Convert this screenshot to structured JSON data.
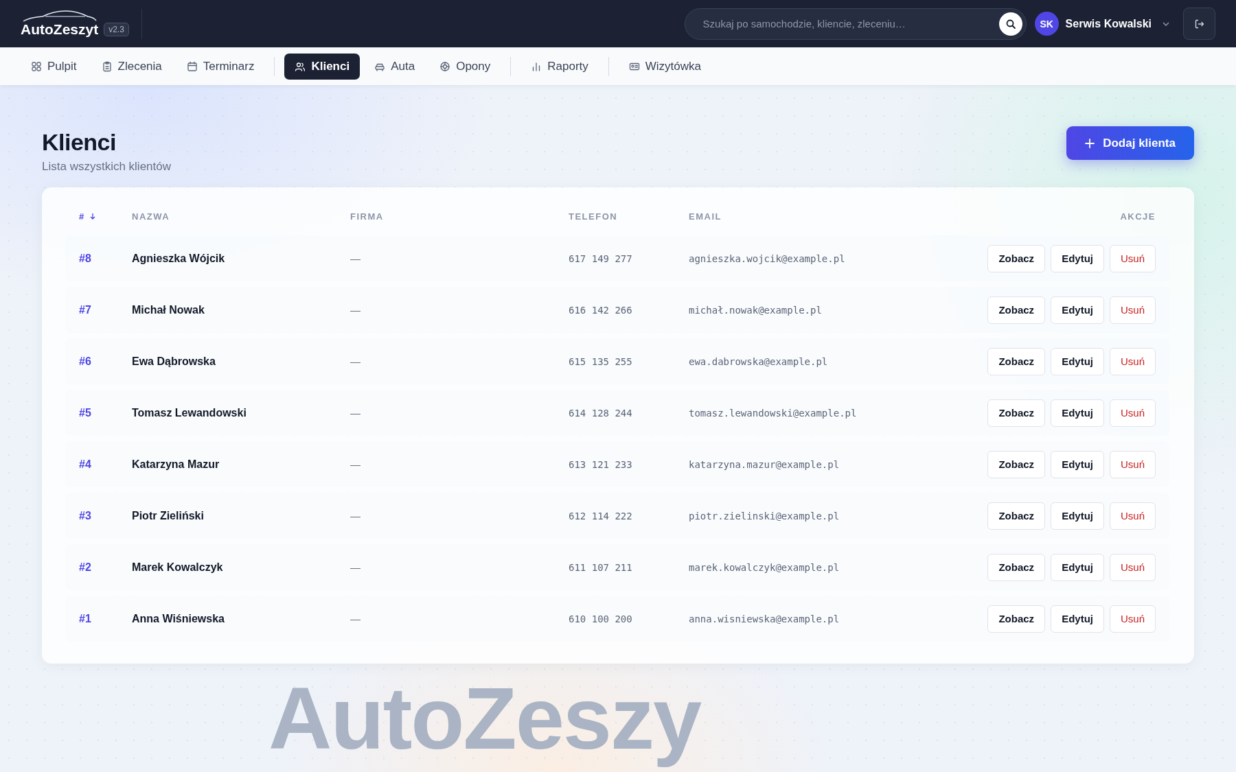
{
  "app": {
    "logo": "AutoZeszyt",
    "version": "v2.3"
  },
  "search": {
    "placeholder": "Szukaj po samochodzie, kliencie, zleceniu…"
  },
  "user": {
    "initials": "SK",
    "name": "Serwis Kowalski"
  },
  "nav": [
    [
      {
        "label": "Pulpit",
        "selected": false
      },
      {
        "label": "Zlecenia",
        "selected": false
      },
      {
        "label": "Terminarz",
        "selected": false
      }
    ],
    [
      {
        "label": "Klienci",
        "selected": true
      },
      {
        "label": "Auta",
        "selected": false
      },
      {
        "label": "Opony",
        "selected": false
      }
    ],
    [
      {
        "label": "Raporty",
        "selected": false
      }
    ],
    [
      {
        "label": "Wizytówka",
        "selected": false
      }
    ]
  ],
  "page": {
    "title": "Klienci",
    "subtitle": "Lista wszystkich klientów",
    "add_button": "Dodaj klienta"
  },
  "table": {
    "columns": [
      {
        "label": "#",
        "sorted": true
      },
      {
        "label": "NAZWA"
      },
      {
        "label": "FIRMA"
      },
      {
        "label": "TELEFON"
      },
      {
        "label": "EMAIL"
      },
      {
        "label": "AKCJE"
      }
    ],
    "rows": [
      {
        "id": "#8",
        "name": "Agnieszka Wójcik",
        "company": "—",
        "phone": "617 149 277",
        "email": "agnieszka.wojcik@example.pl",
        "actions": [
          {
            "label": "Zobacz",
            "kind": "normal"
          },
          {
            "label": "Edytuj",
            "kind": "normal"
          },
          {
            "label": "Usuń",
            "kind": "danger"
          }
        ]
      },
      {
        "id": "#7",
        "name": "Michał Nowak",
        "company": "—",
        "phone": "616 142 266",
        "email": "michał.nowak@example.pl",
        "actions": [
          {
            "label": "Zobacz",
            "kind": "normal"
          },
          {
            "label": "Edytuj",
            "kind": "normal"
          },
          {
            "label": "Usuń",
            "kind": "danger"
          }
        ]
      },
      {
        "id": "#6",
        "name": "Ewa Dąbrowska",
        "company": "—",
        "phone": "615 135 255",
        "email": "ewa.dabrowska@example.pl",
        "actions": [
          {
            "label": "Zobacz",
            "kind": "normal"
          },
          {
            "label": "Edytuj",
            "kind": "normal"
          },
          {
            "label": "Usuń",
            "kind": "danger"
          }
        ]
      },
      {
        "id": "#5",
        "name": "Tomasz Lewandowski",
        "company": "—",
        "phone": "614 128 244",
        "email": "tomasz.lewandowski@example.pl",
        "actions": [
          {
            "label": "Zobacz",
            "kind": "normal"
          },
          {
            "label": "Edytuj",
            "kind": "normal"
          },
          {
            "label": "Usuń",
            "kind": "danger"
          }
        ]
      },
      {
        "id": "#4",
        "name": "Katarzyna Mazur",
        "company": "—",
        "phone": "613 121 233",
        "email": "katarzyna.mazur@example.pl",
        "actions": [
          {
            "label": "Zobacz",
            "kind": "normal"
          },
          {
            "label": "Edytuj",
            "kind": "normal"
          },
          {
            "label": "Usuń",
            "kind": "danger"
          }
        ]
      },
      {
        "id": "#3",
        "name": "Piotr Zieliński",
        "company": "—",
        "phone": "612 114 222",
        "email": "piotr.zielinski@example.pl",
        "actions": [
          {
            "label": "Zobacz",
            "kind": "normal"
          },
          {
            "label": "Edytuj",
            "kind": "normal"
          },
          {
            "label": "Usuń",
            "kind": "danger"
          }
        ]
      },
      {
        "id": "#2",
        "name": "Marek Kowalczyk",
        "company": "—",
        "phone": "611 107 211",
        "email": "marek.kowalczyk@example.pl",
        "actions": [
          {
            "label": "Zobacz",
            "kind": "normal"
          },
          {
            "label": "Edytuj",
            "kind": "normal"
          },
          {
            "label": "Usuń",
            "kind": "danger"
          }
        ]
      },
      {
        "id": "#1",
        "name": "Anna Wiśniewska",
        "company": "—",
        "phone": "610 100 200",
        "email": "anna.wisniewska@example.pl",
        "actions": [
          {
            "label": "Zobacz",
            "kind": "normal"
          },
          {
            "label": "Edytuj",
            "kind": "normal"
          },
          {
            "label": "Usuń",
            "kind": "danger"
          }
        ]
      }
    ]
  },
  "background_text": "AutoZeszy"
}
